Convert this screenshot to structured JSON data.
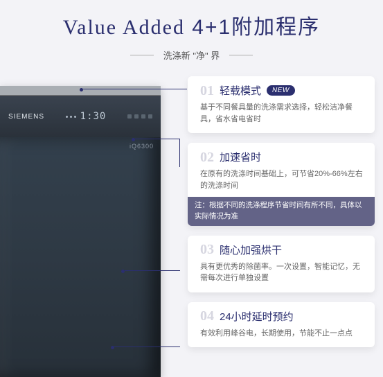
{
  "header": {
    "title_en": "Value Added",
    "title_cn": " 4+1附加程序",
    "subtitle": "洗涤新 \"净\" 界"
  },
  "dishwasher": {
    "brand": "SIEMENS",
    "display_time": "1:30",
    "model": "iQ6300"
  },
  "features": [
    {
      "num": "01",
      "title": "轻载模式",
      "badge": "NEW",
      "desc": "基于不同餐具量的洗涤需求选择，轻松洁净餐具，省水省电省时",
      "note": ""
    },
    {
      "num": "02",
      "title": "加速省时",
      "badge": "",
      "desc": "在原有的洗涤时间基础上，可节省20%-66%左右的洗涤时间",
      "note": "注：根据不同的洗涤程序节省时间有所不同，具体以实际情况为准"
    },
    {
      "num": "03",
      "title": "随心加强烘干",
      "badge": "",
      "desc": "具有更优秀的除菌率。一次设置，智能记忆，无需每次进行单独设置",
      "note": ""
    },
    {
      "num": "04",
      "title": "24小时延时预约",
      "badge": "",
      "desc": "有效利用峰谷电，长期使用，节能不止一点点",
      "note": ""
    }
  ]
}
